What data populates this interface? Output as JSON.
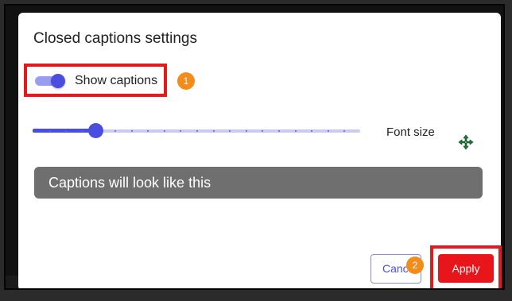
{
  "dialog": {
    "title": "Closed captions settings"
  },
  "show_captions": {
    "label": "Show captions",
    "enabled": true
  },
  "font_size": {
    "label": "Font size",
    "slider_value_fraction": 0.1,
    "tick_count": 20
  },
  "preview": {
    "text": "Captions will look like this"
  },
  "buttons": {
    "cancel_label": "Cancel",
    "apply_label": "Apply"
  },
  "annotations": {
    "badge_1": "1",
    "badge_2": "2"
  },
  "colors": {
    "accent": "#4a4ee0",
    "highlight_box": "#e11b1b",
    "badge": "#f28c1c",
    "apply_button": "#e8151b",
    "preview_background": "#6f6f6f"
  },
  "icons": {
    "cursor": "move-cursor-icon"
  }
}
